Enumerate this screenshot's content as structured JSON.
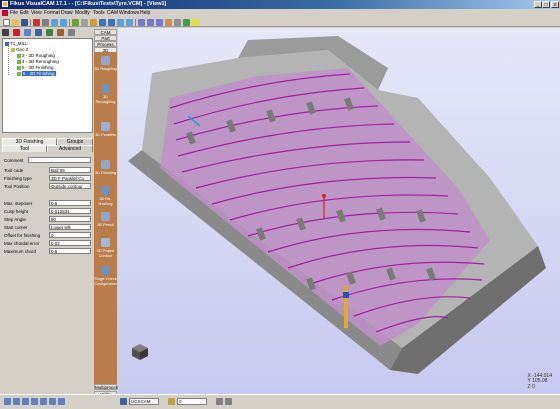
{
  "window": {
    "title": "Fikus VisualCAM 17.1 - - [C:\\Fikus\\Tests\\Tyre.VCM] - [View1]",
    "min": "_",
    "max": "□",
    "close": "x"
  },
  "menu": [
    "File",
    "Edit",
    "View",
    "Format",
    "Draw",
    "Modify",
    "Tools",
    "CAM",
    "Windows",
    "Help"
  ],
  "tree": {
    "root": "T1_MILL",
    "group": "Geo 2",
    "ops": [
      "3 - 3D Roughing",
      "4 - 3D Reroughing",
      "5 - 3D Finishing",
      "6 - 3D Finishing"
    ],
    "selected_index": 3
  },
  "panel_tabs": {
    "top": [
      "3D Finishing",
      "Groups"
    ],
    "bottom": [
      "Tool",
      "Advanced"
    ]
  },
  "properties": [
    {
      "label": "Comment",
      "value": ""
    },
    {
      "label": "Tool code",
      "value": "Ball 05"
    },
    {
      "label": "Finishing type",
      "value": "3D F Parallel Cu"
    },
    {
      "label": "Tool Position",
      "value": "Outside contour"
    },
    {
      "label": "Max. stepover",
      "value": "0.5"
    },
    {
      "label": "Cusp height",
      "value": "0.012531"
    },
    {
      "label": "Step Angle",
      "value": "90"
    },
    {
      "label": "Start corner",
      "value": "Lower left"
    },
    {
      "label": "Offset for finishing",
      "value": "0"
    },
    {
      "label": "Max chordal error",
      "value": "0.02"
    },
    {
      "label": "Maximum chord",
      "value": "0.5"
    }
  ],
  "sidebar": {
    "headers": [
      "CAM",
      "Part",
      "Process",
      "3D Process"
    ],
    "buttons": [
      "3D Roughing",
      "3D Reroughing",
      "3D Parallels",
      "3D Finishing",
      "3D Re-finishing",
      "3D Pencil",
      "3D Project Contour",
      "Single Check Configuration"
    ],
    "footer": [
      "Multiprocess",
      "Utility"
    ]
  },
  "viewport": {
    "coords": [
      "X -144.014",
      "Y 105.08",
      "Z 0"
    ]
  },
  "statusbar": {
    "ucs": "UCSCAM",
    "layer": "0"
  },
  "colors": {
    "toolpath": "#a020a0",
    "part_surface": "#9a9a9a",
    "side_panel": "#b87d4a",
    "viewport_bg": "#d4d6f2"
  }
}
